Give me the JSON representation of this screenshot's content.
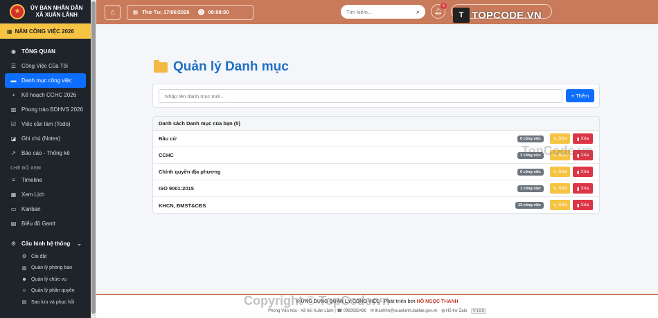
{
  "org": {
    "line1": "ỦY BAN NHÂN DÂN",
    "line2": "XÃ XUÂN LÃNH"
  },
  "year_label": "NĂM CÔNG VIỆC 2026",
  "nav": {
    "items": [
      {
        "label": "TỔNG QUAN",
        "icon": "palette-icon"
      },
      {
        "label": "Công Việc Của Tôi",
        "icon": "tasks-icon"
      },
      {
        "label": "Danh mục công việc",
        "icon": "folder-icon"
      },
      {
        "label": "Kế hoạch CCHC 2026",
        "icon": "briefcase-icon"
      },
      {
        "label": "Phong trào BDHVS 2026",
        "icon": "building-icon"
      },
      {
        "label": "Việc cần làm (Todo)",
        "icon": "check-square-icon"
      },
      {
        "label": "Ghi chú (Notes)",
        "icon": "sticky-note-icon"
      },
      {
        "label": "Báo cáo - Thống kê",
        "icon": "chart-line-icon"
      }
    ],
    "view_section": "CHẾ ĐỘ XEM",
    "view_items": [
      {
        "label": "Timeline",
        "icon": "list-icon"
      },
      {
        "label": "Xem Lịch",
        "icon": "calendar-icon"
      },
      {
        "label": "Kanban",
        "icon": "kanban-icon"
      },
      {
        "label": "Biểu đồ Gantt",
        "icon": "gantt-icon"
      }
    ],
    "config_label": "Cấu hình hệ thống",
    "config_items": [
      {
        "label": "Cài đặt",
        "icon": "gear-icon"
      },
      {
        "label": "Quản lý phòng ban",
        "icon": "building-icon"
      },
      {
        "label": "Quản lý chức vụ",
        "icon": "users-icon"
      },
      {
        "label": "Quản lý phân quyền",
        "icon": "user-shield-icon"
      },
      {
        "label": "Sao lưu và phục hồi",
        "icon": "database-icon"
      }
    ]
  },
  "header": {
    "date": "Thứ Tư, 17/06/2026",
    "time": "08:08:50",
    "search_placeholder": "Tìm kiếm...",
    "notification_count": "5",
    "watermark": "TOPCODE.VN"
  },
  "main": {
    "title": "Quản lý Danh mục",
    "input_placeholder": "Nhập tên danh mục mới...",
    "add_label": "Thêm",
    "list_title": "Danh sách Danh mục của bạn (5)",
    "edit_label": "Sửa",
    "delete_label": "Xóa",
    "categories": [
      {
        "name": "Bầu cử",
        "count": "0 công việc"
      },
      {
        "name": "CCHC",
        "count": "1 công việc"
      },
      {
        "name": "Chính quyền địa phương",
        "count": "0 công việc"
      },
      {
        "name": "ISO 9001:2015",
        "count": "1 công việc"
      },
      {
        "name": "KHCN, ĐMST&CĐS",
        "count": "13 công việc"
      }
    ],
    "watermark": "TopCode.vn"
  },
  "footer": {
    "line1_prefix": "© ỨNG DỤNG QUẢN LÝ CÔNG VIỆC - Phát triển bởi",
    "author": "HỒ NGỌC THANH",
    "address": "Phòng Văn hóa - Xã hội Xuân Lãnh",
    "phone": "0983692436",
    "email": "thanhhn@xuanlanh.daklak.gov.vn",
    "support": "Hỗ trợ Zalo",
    "version": "V 1.0.0",
    "watermark": "Copyright © TopCode.vn"
  }
}
